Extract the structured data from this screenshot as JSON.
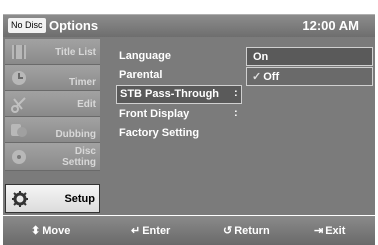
{
  "header": {
    "badge": "No Disc",
    "title": "Options",
    "clock": "12:00 AM"
  },
  "sidebar": {
    "items": [
      {
        "label": "Title List",
        "icon": "film-icon"
      },
      {
        "label": "Timer",
        "icon": "clock-icon"
      },
      {
        "label": "Edit",
        "icon": "scissors-icon"
      },
      {
        "label": "Dubbing",
        "icon": "dubbing-icon"
      },
      {
        "label": "Disc Setting",
        "label_line1": "Disc",
        "label_line2": "Setting",
        "icon": "disc-icon"
      },
      {
        "label": "Setup",
        "icon": "gear-icon"
      }
    ]
  },
  "menu": {
    "items": [
      {
        "label": "Language"
      },
      {
        "label": "Parental"
      },
      {
        "label": "STB Pass-Through"
      },
      {
        "label": "Front Display"
      },
      {
        "label": "Factory Setting"
      }
    ]
  },
  "submenu": {
    "separator": ":",
    "options": [
      {
        "label": "On"
      },
      {
        "label": "Off",
        "checked": true
      }
    ],
    "check_glyph": "✓"
  },
  "footer": {
    "move": "Move",
    "enter": "Enter",
    "return": "Return",
    "exit": "Exit",
    "move_sym": "⬍",
    "enter_sym": "↵",
    "return_sym": "↺",
    "exit_sym": "⇥"
  },
  "colors": {
    "bar": "#7b7b7b",
    "active_tab": "#f0f0f0",
    "text": "#ffffff"
  }
}
